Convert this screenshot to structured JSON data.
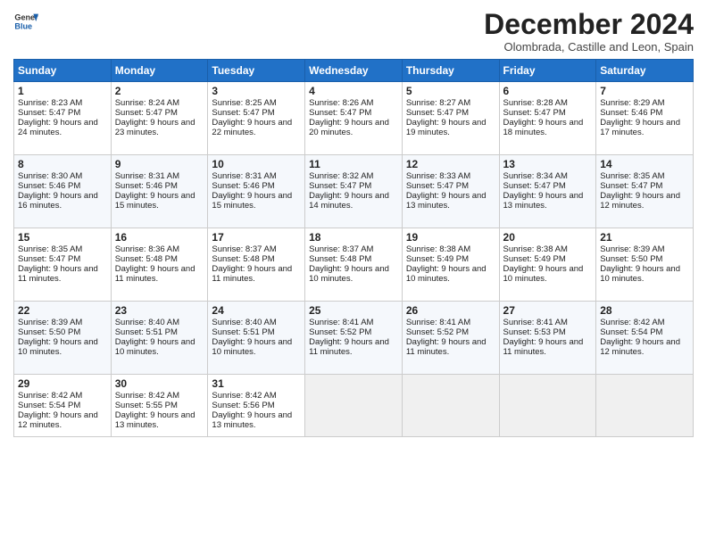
{
  "logo": {
    "line1": "General",
    "line2": "Blue"
  },
  "title": "December 2024",
  "subtitle": "Olombrada, Castille and Leon, Spain",
  "days": [
    "Sunday",
    "Monday",
    "Tuesday",
    "Wednesday",
    "Thursday",
    "Friday",
    "Saturday"
  ],
  "weeks": [
    [
      {
        "day": "1",
        "sunrise": "8:23 AM",
        "sunset": "5:47 PM",
        "daylight": "9 hours and 24 minutes."
      },
      {
        "day": "2",
        "sunrise": "8:24 AM",
        "sunset": "5:47 PM",
        "daylight": "9 hours and 23 minutes."
      },
      {
        "day": "3",
        "sunrise": "8:25 AM",
        "sunset": "5:47 PM",
        "daylight": "9 hours and 22 minutes."
      },
      {
        "day": "4",
        "sunrise": "8:26 AM",
        "sunset": "5:47 PM",
        "daylight": "9 hours and 20 minutes."
      },
      {
        "day": "5",
        "sunrise": "8:27 AM",
        "sunset": "5:47 PM",
        "daylight": "9 hours and 19 minutes."
      },
      {
        "day": "6",
        "sunrise": "8:28 AM",
        "sunset": "5:47 PM",
        "daylight": "9 hours and 18 minutes."
      },
      {
        "day": "7",
        "sunrise": "8:29 AM",
        "sunset": "5:46 PM",
        "daylight": "9 hours and 17 minutes."
      }
    ],
    [
      {
        "day": "8",
        "sunrise": "8:30 AM",
        "sunset": "5:46 PM",
        "daylight": "9 hours and 16 minutes."
      },
      {
        "day": "9",
        "sunrise": "8:31 AM",
        "sunset": "5:46 PM",
        "daylight": "9 hours and 15 minutes."
      },
      {
        "day": "10",
        "sunrise": "8:31 AM",
        "sunset": "5:46 PM",
        "daylight": "9 hours and 15 minutes."
      },
      {
        "day": "11",
        "sunrise": "8:32 AM",
        "sunset": "5:47 PM",
        "daylight": "9 hours and 14 minutes."
      },
      {
        "day": "12",
        "sunrise": "8:33 AM",
        "sunset": "5:47 PM",
        "daylight": "9 hours and 13 minutes."
      },
      {
        "day": "13",
        "sunrise": "8:34 AM",
        "sunset": "5:47 PM",
        "daylight": "9 hours and 13 minutes."
      },
      {
        "day": "14",
        "sunrise": "8:35 AM",
        "sunset": "5:47 PM",
        "daylight": "9 hours and 12 minutes."
      }
    ],
    [
      {
        "day": "15",
        "sunrise": "8:35 AM",
        "sunset": "5:47 PM",
        "daylight": "9 hours and 11 minutes."
      },
      {
        "day": "16",
        "sunrise": "8:36 AM",
        "sunset": "5:48 PM",
        "daylight": "9 hours and 11 minutes."
      },
      {
        "day": "17",
        "sunrise": "8:37 AM",
        "sunset": "5:48 PM",
        "daylight": "9 hours and 11 minutes."
      },
      {
        "day": "18",
        "sunrise": "8:37 AM",
        "sunset": "5:48 PM",
        "daylight": "9 hours and 10 minutes."
      },
      {
        "day": "19",
        "sunrise": "8:38 AM",
        "sunset": "5:49 PM",
        "daylight": "9 hours and 10 minutes."
      },
      {
        "day": "20",
        "sunrise": "8:38 AM",
        "sunset": "5:49 PM",
        "daylight": "9 hours and 10 minutes."
      },
      {
        "day": "21",
        "sunrise": "8:39 AM",
        "sunset": "5:50 PM",
        "daylight": "9 hours and 10 minutes."
      }
    ],
    [
      {
        "day": "22",
        "sunrise": "8:39 AM",
        "sunset": "5:50 PM",
        "daylight": "9 hours and 10 minutes."
      },
      {
        "day": "23",
        "sunrise": "8:40 AM",
        "sunset": "5:51 PM",
        "daylight": "9 hours and 10 minutes."
      },
      {
        "day": "24",
        "sunrise": "8:40 AM",
        "sunset": "5:51 PM",
        "daylight": "9 hours and 10 minutes."
      },
      {
        "day": "25",
        "sunrise": "8:41 AM",
        "sunset": "5:52 PM",
        "daylight": "9 hours and 11 minutes."
      },
      {
        "day": "26",
        "sunrise": "8:41 AM",
        "sunset": "5:52 PM",
        "daylight": "9 hours and 11 minutes."
      },
      {
        "day": "27",
        "sunrise": "8:41 AM",
        "sunset": "5:53 PM",
        "daylight": "9 hours and 11 minutes."
      },
      {
        "day": "28",
        "sunrise": "8:42 AM",
        "sunset": "5:54 PM",
        "daylight": "9 hours and 12 minutes."
      }
    ],
    [
      {
        "day": "29",
        "sunrise": "8:42 AM",
        "sunset": "5:54 PM",
        "daylight": "9 hours and 12 minutes."
      },
      {
        "day": "30",
        "sunrise": "8:42 AM",
        "sunset": "5:55 PM",
        "daylight": "9 hours and 13 minutes."
      },
      {
        "day": "31",
        "sunrise": "8:42 AM",
        "sunset": "5:56 PM",
        "daylight": "9 hours and 13 minutes."
      },
      null,
      null,
      null,
      null
    ]
  ]
}
